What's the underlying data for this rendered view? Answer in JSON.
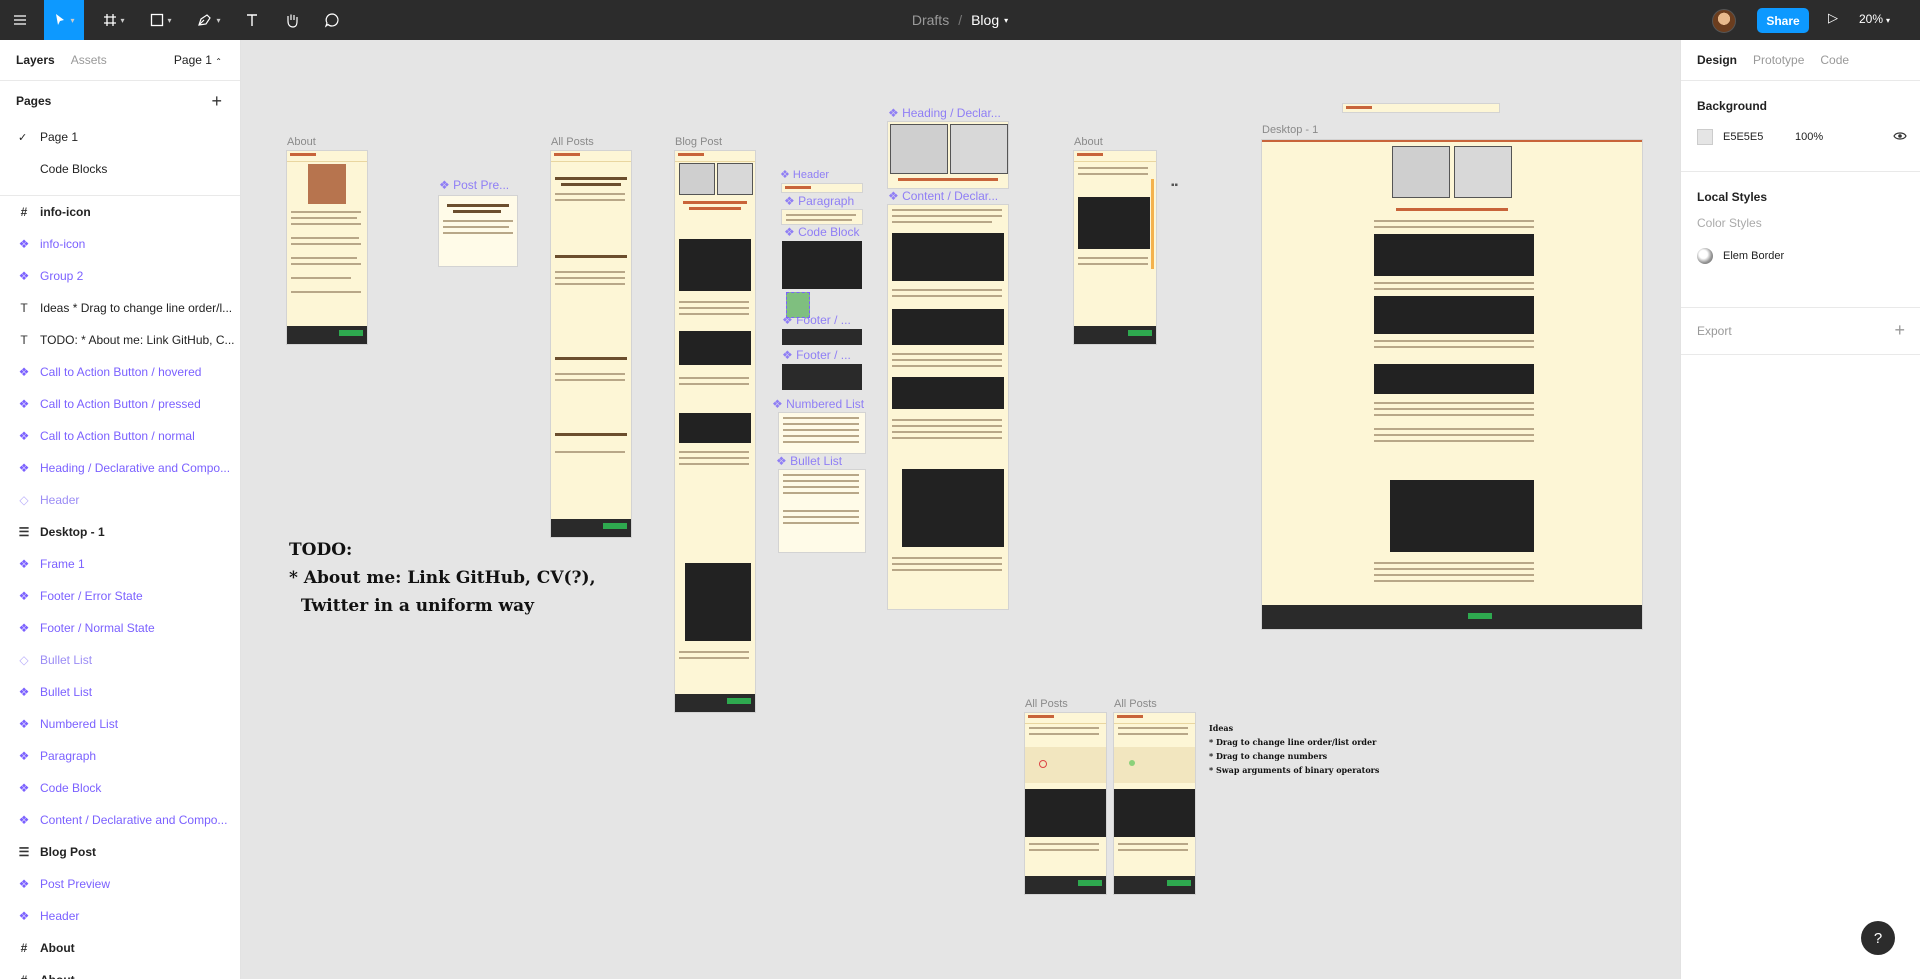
{
  "toolbar": {
    "tools": [
      "menu-icon",
      "move-icon",
      "frame-icon",
      "shape-icon",
      "pen-icon",
      "text-icon",
      "hand-icon",
      "comment-icon"
    ],
    "accent": "#0d99ff"
  },
  "breadcrumb": {
    "project": "Drafts",
    "separator": "/",
    "file": "Blog"
  },
  "share_label": "Share",
  "zoom_label": "20%",
  "left_panel": {
    "tab_layers": "Layers",
    "tab_assets": "Assets",
    "page_selector": "Page 1",
    "pages_title": "Pages",
    "pages": [
      {
        "label": "Page 1",
        "selected": true
      },
      {
        "label": "Code Blocks",
        "selected": false
      }
    ],
    "layers": [
      {
        "icon": "frame-icon",
        "label": "info-icon",
        "kind": "bold"
      },
      {
        "icon": "component-icon",
        "label": "info-icon",
        "kind": "comp"
      },
      {
        "icon": "component-icon",
        "label": "Group 2",
        "kind": "comp"
      },
      {
        "icon": "text-icon",
        "label": "Ideas * Drag to change line order/l...",
        "kind": "plain"
      },
      {
        "icon": "text-icon",
        "label": "TODO: * About me: Link GitHub, C...",
        "kind": "plain"
      },
      {
        "icon": "component-icon",
        "label": "Call to Action Button / hovered",
        "kind": "comp"
      },
      {
        "icon": "component-icon",
        "label": "Call to Action Button / pressed",
        "kind": "comp"
      },
      {
        "icon": "component-icon",
        "label": "Call to Action Button / normal",
        "kind": "comp"
      },
      {
        "icon": "component-icon",
        "label": "Heading / Declarative and Compo...",
        "kind": "comp"
      },
      {
        "icon": "instance-icon",
        "label": "Header",
        "kind": "inst"
      },
      {
        "icon": "stack-icon",
        "label": "Desktop - 1",
        "kind": "bold"
      },
      {
        "icon": "component-icon",
        "label": "Frame 1",
        "kind": "comp"
      },
      {
        "icon": "component-icon",
        "label": "Footer / Error State",
        "kind": "comp"
      },
      {
        "icon": "component-icon",
        "label": "Footer / Normal State",
        "kind": "comp"
      },
      {
        "icon": "instance-icon",
        "label": "Bullet List",
        "kind": "inst"
      },
      {
        "icon": "component-icon",
        "label": "Bullet List",
        "kind": "comp"
      },
      {
        "icon": "component-icon",
        "label": "Numbered List",
        "kind": "comp"
      },
      {
        "icon": "component-icon",
        "label": "Paragraph",
        "kind": "comp"
      },
      {
        "icon": "component-icon",
        "label": "Code Block",
        "kind": "comp"
      },
      {
        "icon": "component-icon",
        "label": "Content / Declarative and Compo...",
        "kind": "comp"
      },
      {
        "icon": "stack-icon",
        "label": "Blog Post",
        "kind": "bold"
      },
      {
        "icon": "component-icon",
        "label": "Post Preview",
        "kind": "comp"
      },
      {
        "icon": "component-icon",
        "label": "Header",
        "kind": "comp"
      },
      {
        "icon": "frame-icon",
        "label": "About",
        "kind": "bold"
      },
      {
        "icon": "frame-icon",
        "label": "About",
        "kind": "bold"
      }
    ]
  },
  "canvas": {
    "frame_labels": {
      "about": "About",
      "all_posts": "All Posts",
      "blog_post": "Blog Post",
      "about2": "About",
      "desktop": "Desktop - 1",
      "all_posts_b1": "All Posts",
      "all_posts_b2": "All Posts"
    },
    "component_labels": {
      "post_preview": "❖ Post Pre...",
      "header": "❖ Header",
      "paragraph": "❖ Paragraph",
      "code_block": "❖ Code Block",
      "footer_a": "❖ Footer / ...",
      "footer_b": "❖ Footer / ...",
      "numbered_list": "❖ Numbered List",
      "bullet_list": "❖ Bullet List",
      "heading_decl": "❖ Heading / Declar...",
      "content_decl": "❖ Content / Declar..."
    },
    "todo_text": "TODO:\n* About me: Link GitHub, CV(?),\n  Twitter in a uniform way",
    "ideas_text": "Ideas\n* Drag to change line order/list order\n* Drag to change numbers\n* Swap arguments of binary operators",
    "frame_bg": "#fdf6d6",
    "brand_color": "#c8643a"
  },
  "right_panel": {
    "tab_design": "Design",
    "tab_prototype": "Prototype",
    "tab_code": "Code",
    "background_title": "Background",
    "background_hex": "E5E5E5",
    "background_opacity": "100%",
    "local_styles_title": "Local Styles",
    "color_styles_label": "Color Styles",
    "effect_style_name": "Elem Border",
    "export_title": "Export"
  },
  "help_label": "?"
}
